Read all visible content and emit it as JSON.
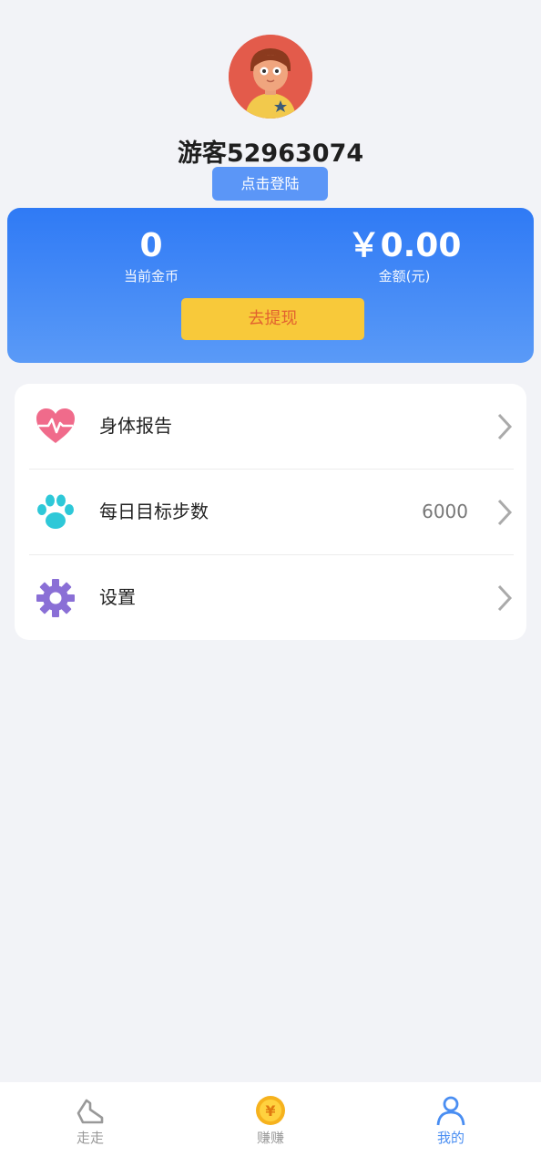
{
  "profile": {
    "username": "游客52963074",
    "login_label": "点击登陆"
  },
  "balance": {
    "coins_value": "0",
    "coins_label": "当前金币",
    "amount_value": "￥0.00",
    "amount_label": "金额(元)",
    "withdraw_label": "去提现"
  },
  "menu": {
    "items": [
      {
        "label": "身体报告",
        "icon": "heart-rate-icon",
        "color": "#f06b8b"
      },
      {
        "label": "每日目标步数",
        "value": "6000",
        "icon": "paw-icon",
        "color": "#2ec8d8"
      },
      {
        "label": "设置",
        "icon": "gear-icon",
        "color": "#8a6fd6"
      }
    ]
  },
  "nav": {
    "items": [
      {
        "label": "走走",
        "icon": "shoe-icon"
      },
      {
        "label": "赚赚",
        "icon": "coin-icon"
      },
      {
        "label": "我的",
        "icon": "user-icon",
        "active": true
      }
    ]
  },
  "colors": {
    "accent": "#2f7af5",
    "withdraw_bg": "#f8c93a",
    "withdraw_text": "#e2622f",
    "nav_active": "#4a8ef2"
  }
}
